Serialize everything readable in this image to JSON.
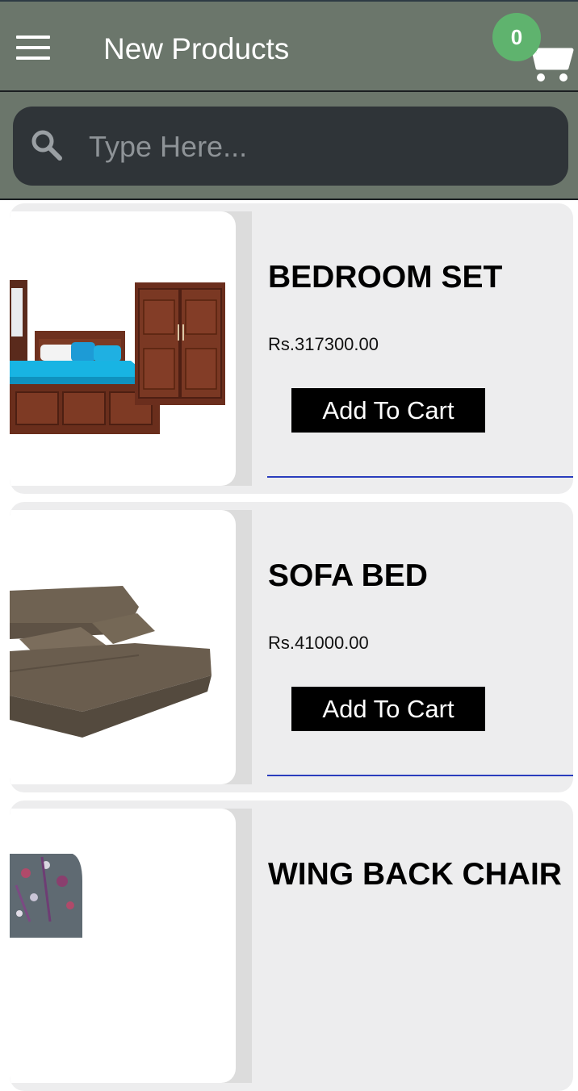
{
  "header": {
    "title": "New Products",
    "cart_count": "0"
  },
  "search": {
    "placeholder": "Type Here..."
  },
  "products": [
    {
      "name": "BEDROOM SET",
      "price": "Rs.317300.00",
      "button": "Add To Cart"
    },
    {
      "name": "SOFA BED",
      "price": "Rs.41000.00",
      "button": "Add To Cart"
    },
    {
      "name": "WING BACK CHAIR"
    }
  ],
  "colors": {
    "appbar": "#6b766b",
    "badge": "#5fb36e",
    "search_bg": "#2f3438",
    "card_bg": "#ededee",
    "button_bg": "#000000",
    "underline": "#2a3dbd"
  },
  "icons": {
    "menu": "menu-icon",
    "cart": "cart-icon",
    "search": "search-icon"
  }
}
